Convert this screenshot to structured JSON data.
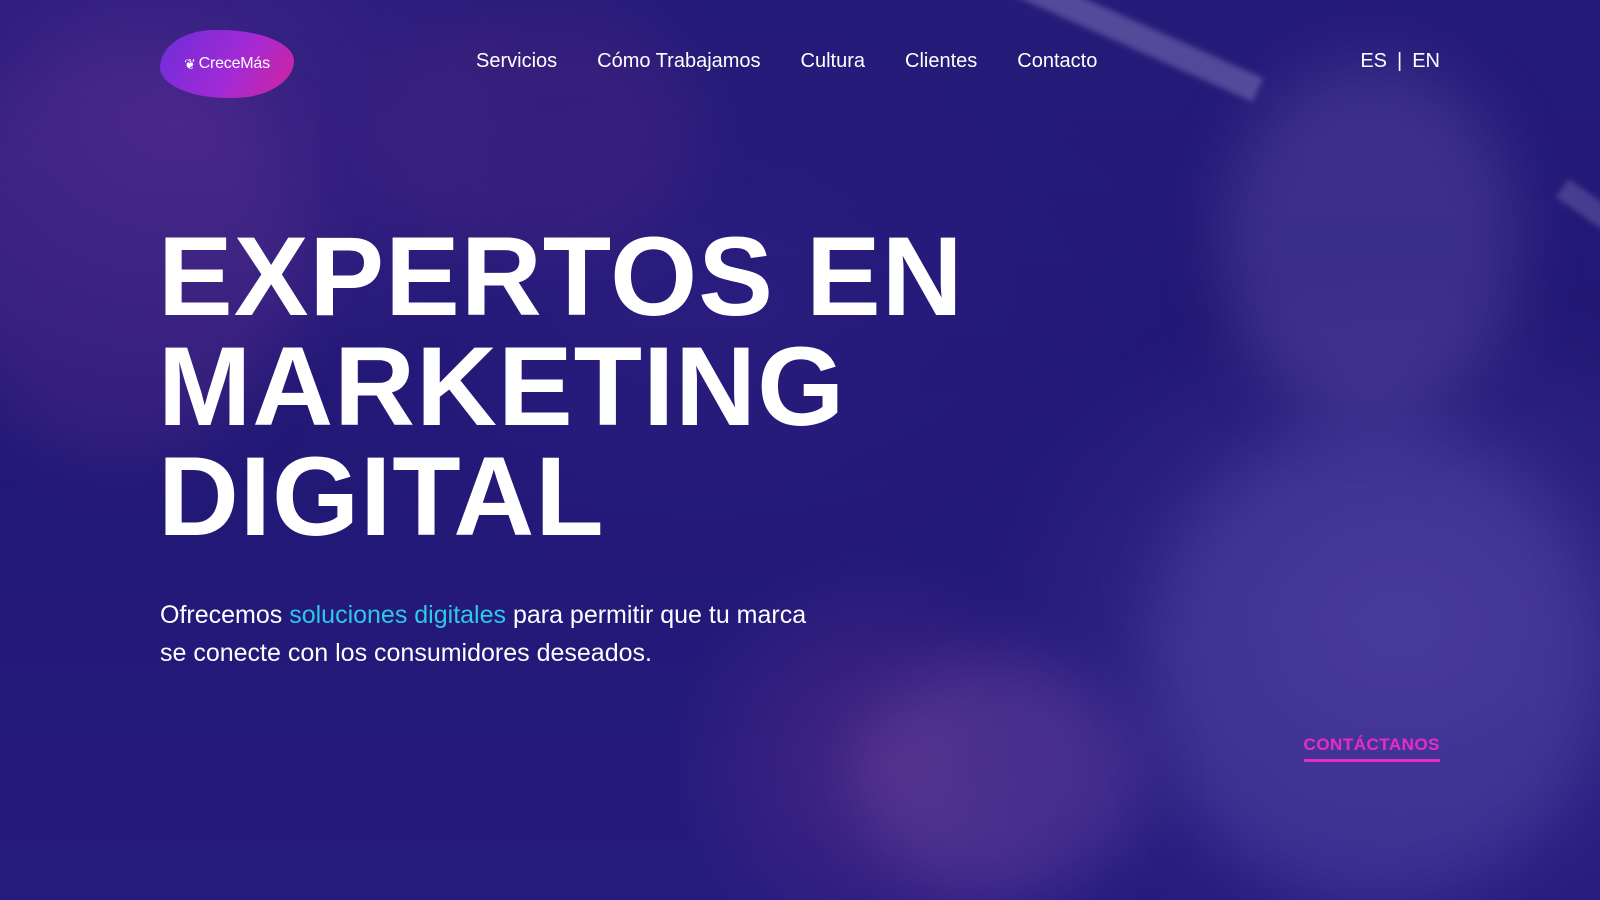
{
  "brand": {
    "logo_text": "CreceMás",
    "logo_icon": "sprout-icon"
  },
  "nav": {
    "items": [
      {
        "label": "Servicios"
      },
      {
        "label": "Cómo Trabajamos"
      },
      {
        "label": "Cultura"
      },
      {
        "label": "Clientes"
      },
      {
        "label": "Contacto"
      }
    ]
  },
  "lang": {
    "es": "ES",
    "separator": "|",
    "en": "EN"
  },
  "hero": {
    "headline_lines": [
      "EXPERTOS EN",
      "MARKETING",
      "DIGITAL"
    ],
    "sub_before": "Ofrecemos ",
    "sub_highlight": "soluciones digitales",
    "sub_after": " para permitir que tu marca se conecte con los consumidores deseados.",
    "cta_label": "CONTÁCTANOS"
  },
  "colors": {
    "background": "#1c1566",
    "highlight": "#2ec8e6",
    "cta": "#e12cc6",
    "logo_gradient_start": "#6b2ed9",
    "logo_gradient_end": "#d3239a"
  }
}
